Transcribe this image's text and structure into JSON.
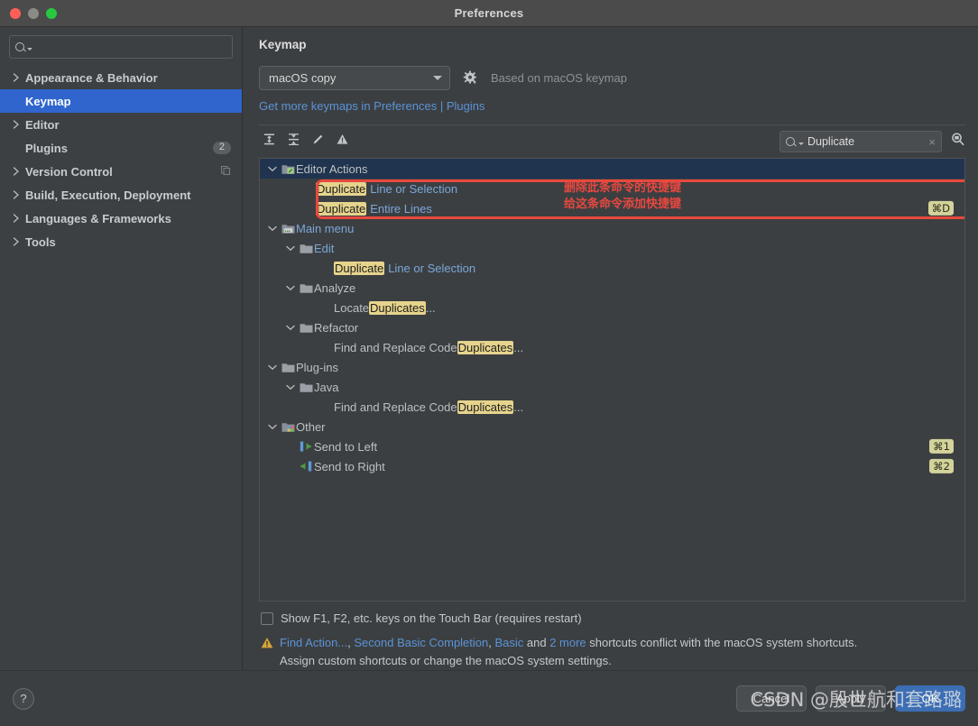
{
  "window": {
    "title": "Preferences",
    "traffic_lights": [
      "close",
      "minimize",
      "zoom"
    ]
  },
  "sidebar": {
    "search_placeholder": "",
    "items": [
      {
        "label": "Appearance & Behavior",
        "expandable": true,
        "selected": false,
        "badge": ""
      },
      {
        "label": "Keymap",
        "expandable": false,
        "selected": true,
        "badge": ""
      },
      {
        "label": "Editor",
        "expandable": true,
        "selected": false,
        "badge": ""
      },
      {
        "label": "Plugins",
        "expandable": false,
        "selected": false,
        "badge": "2"
      },
      {
        "label": "Version Control",
        "expandable": true,
        "selected": false,
        "badge": ""
      },
      {
        "label": "Build, Execution, Deployment",
        "expandable": true,
        "selected": false,
        "badge": ""
      },
      {
        "label": "Languages & Frameworks",
        "expandable": true,
        "selected": false,
        "badge": ""
      },
      {
        "label": "Tools",
        "expandable": true,
        "selected": false,
        "badge": ""
      }
    ]
  },
  "main": {
    "title": "Keymap",
    "keymap_select_value": "macOS copy",
    "based_on_text": "Based on macOS keymap",
    "get_more_link": "Get more keymaps in Preferences | Plugins",
    "toolbar_icons": [
      "expand-all-icon",
      "collapse-all-icon",
      "edit-shortcut-icon",
      "show-conflicts-icon"
    ],
    "find_value": "Duplicate",
    "find_clear_label": "×",
    "find_actions_icon": "find-actions-icon"
  },
  "tree": {
    "rows": [
      {
        "id": "editor-actions",
        "depth": 0,
        "twisty": "down",
        "icon": "editor-actions-icon",
        "label_plain": "Editor Actions",
        "selected": true,
        "style": "grey",
        "shortcut": ""
      },
      {
        "id": "duplicate-line-or-selection",
        "depth": 2,
        "twisty": "",
        "icon": "",
        "label_hl": "Duplicate",
        "label_rest": "Line or Selection",
        "selected": false,
        "style": "blue",
        "shortcut": ""
      },
      {
        "id": "duplicate-entire-lines",
        "depth": 2,
        "twisty": "",
        "icon": "",
        "label_hl": "Duplicate",
        "label_rest": "Entire Lines",
        "selected": false,
        "style": "blue",
        "shortcut": "⌘D"
      },
      {
        "id": "main-menu",
        "depth": 0,
        "twisty": "down",
        "icon": "main-menu-icon",
        "label_plain": "Main menu",
        "selected": false,
        "style": "blue",
        "shortcut": ""
      },
      {
        "id": "edit",
        "depth": 1,
        "twisty": "down",
        "icon": "folder-icon",
        "label_plain": "Edit",
        "selected": false,
        "style": "blue",
        "shortcut": ""
      },
      {
        "id": "edit-duplicate-line-or-selection",
        "depth": 3,
        "twisty": "",
        "icon": "",
        "label_hl": "Duplicate",
        "label_rest": "Line or Selection",
        "selected": false,
        "style": "blue",
        "shortcut": ""
      },
      {
        "id": "analyze",
        "depth": 1,
        "twisty": "down",
        "icon": "folder-icon",
        "label_plain": "Analyze",
        "selected": false,
        "style": "grey",
        "shortcut": ""
      },
      {
        "id": "locate-duplicates",
        "depth": 3,
        "twisty": "",
        "icon": "",
        "label_pre": "Locate ",
        "label_hl": "Duplicates",
        "label_rest": "...",
        "selected": false,
        "style": "grey",
        "shortcut": ""
      },
      {
        "id": "refactor",
        "depth": 1,
        "twisty": "down",
        "icon": "folder-icon",
        "label_plain": "Refactor",
        "selected": false,
        "style": "grey",
        "shortcut": ""
      },
      {
        "id": "find-and-replace-code-duplicates-menu",
        "depth": 3,
        "twisty": "",
        "icon": "",
        "label_pre": "Find and Replace Code ",
        "label_hl": "Duplicates",
        "label_rest": "...",
        "selected": false,
        "style": "grey",
        "shortcut": ""
      },
      {
        "id": "plug-ins",
        "depth": 0,
        "twisty": "down",
        "icon": "folder-icon",
        "label_plain": "Plug-ins",
        "selected": false,
        "style": "grey",
        "shortcut": ""
      },
      {
        "id": "java",
        "depth": 1,
        "twisty": "down",
        "icon": "folder-icon",
        "label_plain": "Java",
        "selected": false,
        "style": "grey",
        "shortcut": ""
      },
      {
        "id": "find-and-replace-code-duplicates-java",
        "depth": 3,
        "twisty": "",
        "icon": "",
        "label_pre": "Find and Replace Code ",
        "label_hl": "Duplicates",
        "label_rest": "...",
        "selected": false,
        "style": "grey",
        "shortcut": ""
      },
      {
        "id": "other",
        "depth": 0,
        "twisty": "down",
        "icon": "other-icon",
        "label_plain": "Other",
        "selected": false,
        "style": "grey",
        "shortcut": ""
      },
      {
        "id": "send-to-left",
        "depth": 1,
        "twisty": "",
        "icon": "send-left-icon",
        "label_plain": "Send to Left",
        "selected": false,
        "style": "grey",
        "shortcut": "⌘1"
      },
      {
        "id": "send-to-right",
        "depth": 1,
        "twisty": "",
        "icon": "send-right-icon",
        "label_plain": "Send to Right",
        "selected": false,
        "style": "grey",
        "shortcut": "⌘2"
      }
    ]
  },
  "annotation": {
    "line1": "删除此条命令的快捷键",
    "line2": "给这条命令添加快捷键",
    "box_color": "#e8483f"
  },
  "footer_area": {
    "touchbar_checkbox_label": "Show F1, F2, etc. keys on the Touch Bar (requires restart)",
    "touchbar_checked": false,
    "conflict": {
      "link1": "Find Action...",
      "sep1": ", ",
      "link2": "Second Basic Completion",
      "sep2": ", ",
      "link3": "Basic",
      "mid": " and ",
      "link4": "2 more",
      "tail": " shortcuts conflict with the macOS system shortcuts.",
      "line2": "Assign custom shortcuts or change the macOS system settings."
    }
  },
  "footer": {
    "help_label": "?",
    "cancel_label": "Cancel",
    "apply_label": "Apply",
    "ok_label": "OK"
  },
  "watermark": {
    "text": "CSDN @殷世航和套路璐"
  },
  "colors": {
    "accent_blue": "#2f65cd",
    "link_blue": "#5a93d8",
    "highlight_yellow": "#e6d48d",
    "annotation_red": "#e8483f",
    "primary_button": "#3c6eb4"
  }
}
